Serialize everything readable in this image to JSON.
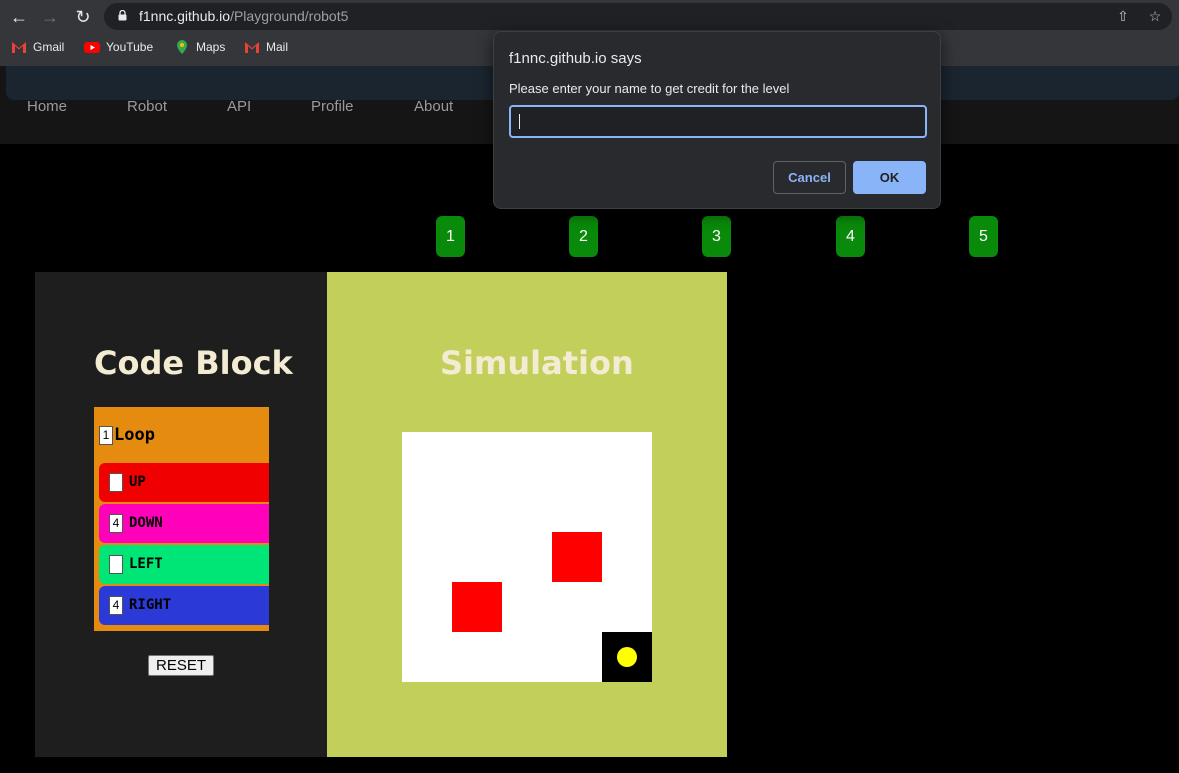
{
  "browser": {
    "url_host": "f1nnc.github.io",
    "url_path": "/Playground/robot5",
    "bookmarks": [
      "Gmail",
      "YouTube",
      "Maps",
      "Mail"
    ]
  },
  "site": {
    "nav": [
      "Home",
      "Robot",
      "API",
      "Profile",
      "About"
    ],
    "levels": [
      "1",
      "2",
      "3",
      "4",
      "5"
    ]
  },
  "code_block": {
    "title": "Code Block",
    "loop": {
      "count": "1",
      "label": "Loop"
    },
    "commands": [
      {
        "label": "UP",
        "count": "",
        "color": "#f00000"
      },
      {
        "label": "DOWN",
        "count": "4",
        "color": "#ff00bb"
      },
      {
        "label": "LEFT",
        "count": "",
        "color": "#00e676"
      },
      {
        "label": "RIGHT",
        "count": "4",
        "color": "#2b3ad6"
      }
    ],
    "reset_label": "RESET"
  },
  "simulation": {
    "title": "Simulation",
    "grid_size": 5,
    "obstacles": [
      {
        "row": 2,
        "col": 3
      },
      {
        "row": 3,
        "col": 1
      }
    ],
    "goal": {
      "row": 4,
      "col": 4
    },
    "colors": {
      "obstacle": "#ff0000",
      "goal_bg": "#000000",
      "robot": "#ffff00"
    }
  },
  "dialog": {
    "title": "f1nnc.github.io says",
    "message": "Please enter your name to get credit for the level",
    "input_value": "",
    "cancel_label": "Cancel",
    "ok_label": "OK"
  }
}
